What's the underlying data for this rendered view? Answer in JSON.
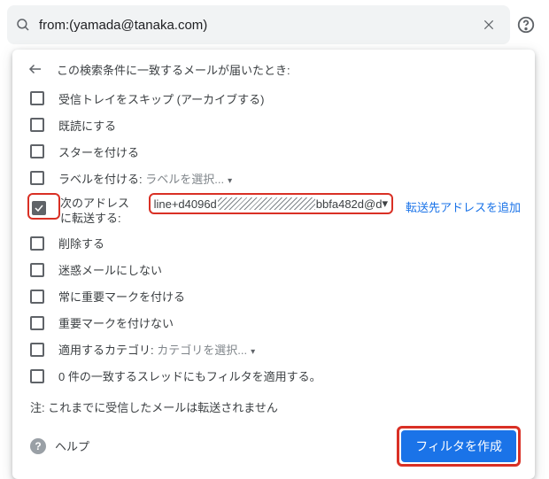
{
  "search": {
    "value": "from:(yamada@tanaka.com)"
  },
  "header_title": "この検索条件に一致するメールが届いたとき:",
  "options": {
    "skip_inbox": "受信トレイをスキップ (アーカイブする)",
    "mark_read": "既読にする",
    "star": "スターを付ける",
    "label_prefix": "ラベルを付ける: ",
    "label_select": "ラベルを選択...",
    "forward_label": "次のアドレスに転送する:",
    "delete": "削除する",
    "never_spam": "迷惑メールにしない",
    "always_important": "常に重要マークを付ける",
    "never_important": "重要マークを付けない",
    "category_prefix": "適用するカテゴリ: ",
    "category_select": "カテゴリを選択...",
    "apply_matching": "0 件の一致するスレッドにもフィルタを適用する。"
  },
  "forward_address": {
    "prefix": "line+d4096d",
    "suffix": "bbfa482d@d"
  },
  "add_forward": "転送先アドレスを追加",
  "note": "注: これまでに受信したメールは転送されません",
  "help": "ヘルプ",
  "create_button": "フィルタを作成",
  "checkbox_states": {
    "forward": true
  }
}
